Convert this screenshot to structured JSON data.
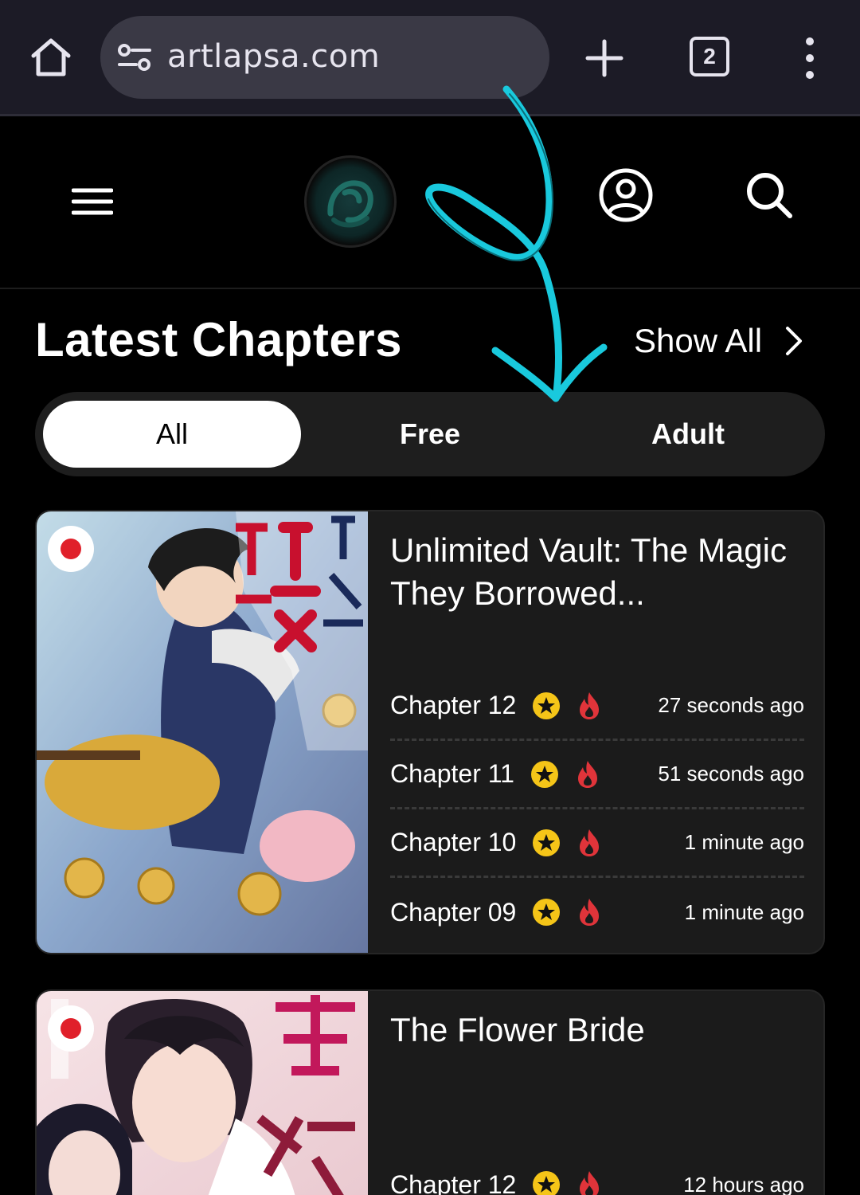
{
  "browser": {
    "url": "artlapsa.com",
    "tab_count": "2",
    "icons": [
      "home-icon",
      "site-settings-icon",
      "plus-icon",
      "tabs-icon",
      "more-vert-icon"
    ]
  },
  "header": {
    "icons": [
      "menu-icon",
      "site-logo",
      "account-icon",
      "search-icon"
    ]
  },
  "latest": {
    "title": "Latest Chapters",
    "show_all": "Show All"
  },
  "filters": {
    "all": "All",
    "free": "Free",
    "adult": "Adult",
    "selected": "All"
  },
  "series": [
    {
      "title": "Unlimited Vault: The Magic They Borrowed...",
      "chapters": [
        {
          "label": "Chapter 12",
          "time": "27 seconds ago"
        },
        {
          "label": "Chapter 11",
          "time": "51 seconds ago"
        },
        {
          "label": "Chapter 10",
          "time": "1 minute ago"
        },
        {
          "label": "Chapter 09",
          "time": "1 minute ago"
        }
      ]
    },
    {
      "title": "The Flower Bride",
      "chapters": [
        {
          "label": "Chapter 12",
          "time": "12 hours ago"
        }
      ]
    }
  ],
  "colors": {
    "accent_annotation": "#19c9dd",
    "star": "#f5c518",
    "fire": "#e0343a",
    "card_bg": "#1b1b1b"
  }
}
